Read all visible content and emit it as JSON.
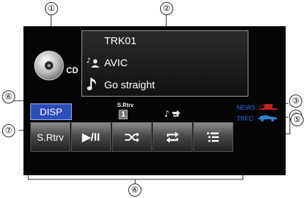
{
  "track": {
    "label": "TRK01",
    "artist": "AVIC",
    "title": "Go straight"
  },
  "source": {
    "label": "CD"
  },
  "disp_button": {
    "label": "DISP"
  },
  "srtrv_indicator": {
    "label": "S.Rtrv",
    "value": "1"
  },
  "status": {
    "news": "NEWS",
    "trfc": "TRFC"
  },
  "controls": [
    {
      "label": "S.Rtrv"
    },
    {
      "label": "▶/II"
    }
  ],
  "callouts": [
    "①",
    "②",
    "③",
    "④",
    "⑤",
    "⑥",
    "⑥",
    "⑦"
  ],
  "colors": {
    "disp_button": "#2b4fb8",
    "status_text": "#2f6fe0",
    "news_icon": "#c82020",
    "trfc_icon": "#2e84d6"
  }
}
